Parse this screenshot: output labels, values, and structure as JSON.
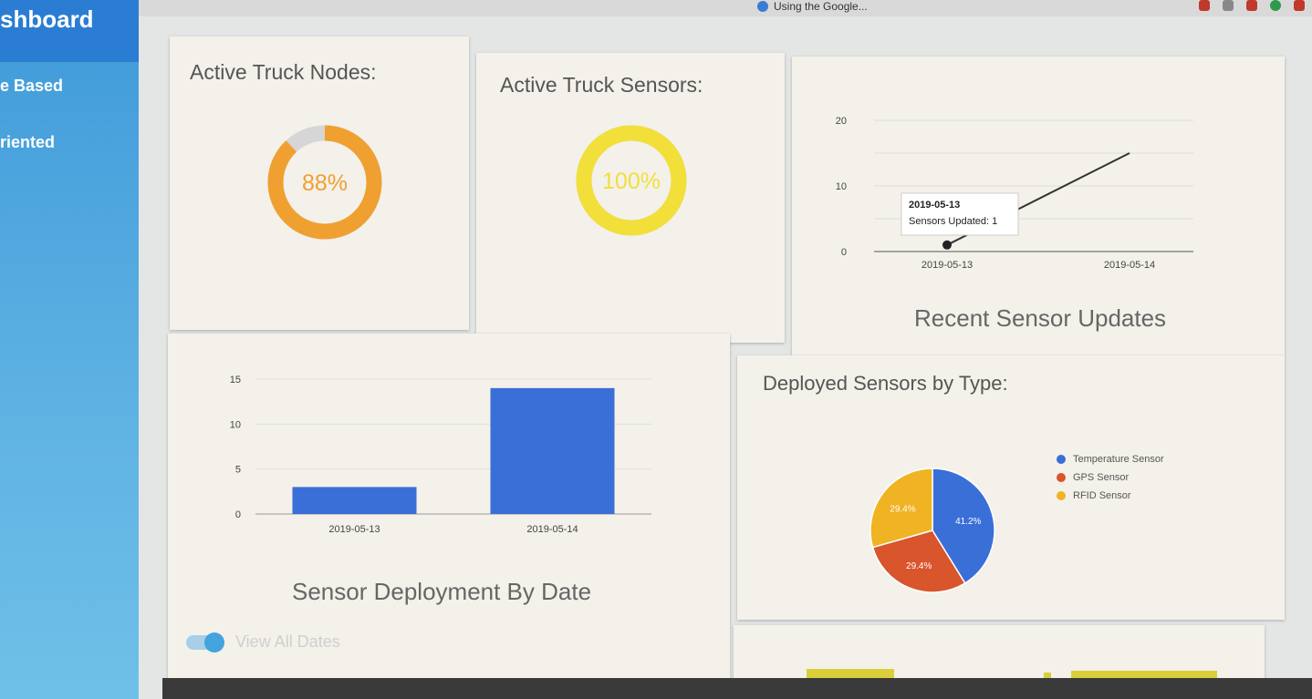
{
  "browser": {
    "tab_hint": "Using the Google..."
  },
  "sidebar": {
    "title": "shboard",
    "items": [
      {
        "label": "e Based"
      },
      {
        "label": "riented"
      }
    ]
  },
  "cards": {
    "nodes": {
      "title": "Active Truck Nodes:",
      "percent_label": "88%",
      "percent": 88,
      "color": "#f0a030",
      "track": "#d6d6d6"
    },
    "sensors": {
      "title": "Active Truck Sensors:",
      "percent_label": "100%",
      "percent": 100,
      "color": "#f2df3a",
      "track": "#d6d6d6"
    }
  },
  "recent_updates": {
    "title": "Recent Sensor Updates",
    "tooltip": {
      "date": "2019-05-13",
      "text": "Sensors Updated: 1"
    }
  },
  "deployment": {
    "title": "Sensor Deployment By Date",
    "toggle_label": "View All Dates"
  },
  "sensors_by_type": {
    "title": "Deployed Sensors by Type:"
  },
  "chart_data": [
    {
      "type": "line",
      "title": "Recent Sensor Updates",
      "x": [
        "2019-05-13",
        "2019-05-14"
      ],
      "series": [
        {
          "values": [
            1,
            15
          ]
        }
      ],
      "yticks": [
        "20",
        "10",
        "0"
      ],
      "ylim": [
        0,
        20
      ],
      "grid": true,
      "color": "#333333"
    },
    {
      "type": "bar",
      "title": "Sensor Deployment By Date",
      "categories": [
        "2019-05-13",
        "2019-05-14"
      ],
      "values": [
        3,
        14
      ],
      "yticks": [
        "15",
        "10",
        "5",
        "0"
      ],
      "ylim": [
        0,
        15
      ],
      "grid": true,
      "color": "#3a6fd8"
    },
    {
      "type": "pie",
      "title": "Deployed Sensors by Type:",
      "labels": [
        "Temperature Sensor",
        "GPS Sensor",
        "RFID Sensor"
      ],
      "values": [
        41.2,
        29.4,
        29.4
      ],
      "value_labels": [
        "41.2%",
        "29.4%",
        "29.4%"
      ],
      "colors": [
        "#3a6fd8",
        "#d9552b",
        "#f0b323"
      ],
      "legend": "right"
    }
  ]
}
